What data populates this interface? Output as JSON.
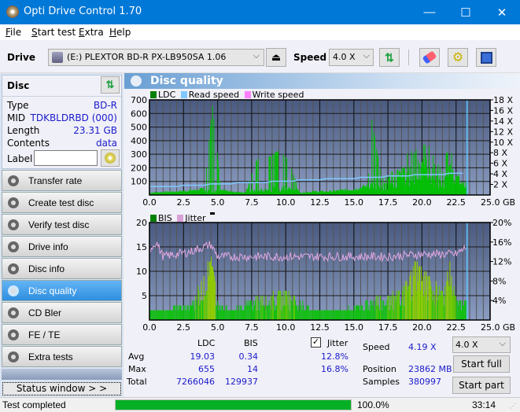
{
  "window": {
    "title": "Opti Drive Control 1.70",
    "minimize": "—",
    "maximize": "☐",
    "close": "✕"
  },
  "menu": [
    {
      "first": "F",
      "rest": "ile"
    },
    {
      "first": "S",
      "rest": "tart test"
    },
    {
      "first": "E",
      "rest": "xtra"
    },
    {
      "first": "H",
      "rest": "elp"
    }
  ],
  "toolbar": {
    "drive_label": "Drive",
    "drive_value": "(E:)  PLEXTOR BD-R  PX-LB950SA 1.06",
    "speed_label": "Speed",
    "speed_value": "4.0 X"
  },
  "disc": {
    "header": "Disc",
    "rows": [
      {
        "label": "Type",
        "value": "BD-R"
      },
      {
        "label": "MID",
        "value": "TDKBLDRBD (000)"
      },
      {
        "label": "Length",
        "value": "23.31 GB"
      },
      {
        "label": "Contents",
        "value": "data"
      }
    ],
    "label_field": "Label",
    "label_value": ""
  },
  "nav": [
    {
      "label": "Transfer rate",
      "active": false
    },
    {
      "label": "Create test disc",
      "active": false
    },
    {
      "label": "Verify test disc",
      "active": false
    },
    {
      "label": "Drive info",
      "active": false
    },
    {
      "label": "Disc info",
      "active": false
    },
    {
      "label": "Disc quality",
      "active": true
    },
    {
      "label": "CD Bler",
      "active": false
    },
    {
      "label": "FE / TE",
      "active": false
    },
    {
      "label": "Extra tests",
      "active": false
    }
  ],
  "status_window": "Status window > >",
  "panel_title": "Disc quality",
  "chart_data": [
    {
      "type": "bar",
      "title": "LDC",
      "legend": [
        "LDC",
        "Read speed",
        "Write speed"
      ],
      "colors": {
        "LDC": "#00c000",
        "Read speed": "#80c8ff",
        "Write speed": "#ff80ff"
      },
      "xlabel": "GB",
      "x_ticks": [
        "0.0",
        "2.5",
        "5.0",
        "7.5",
        "10.0",
        "12.5",
        "15.0",
        "17.5",
        "20.0",
        "22.5",
        "25.0 GB"
      ],
      "xlim": [
        0,
        25
      ],
      "ylim": [
        0,
        700
      ],
      "y_ticks": [
        "100",
        "200",
        "300",
        "400",
        "500",
        "600",
        "700"
      ],
      "y2_ticks": [
        "2 X",
        "4 X",
        "6 X",
        "8 X",
        "10 X",
        "12 X",
        "14 X",
        "16 X",
        "18 X"
      ],
      "y2lim": [
        0,
        18
      ],
      "ldc_profile": [
        [
          0,
          20
        ],
        [
          1,
          25
        ],
        [
          2,
          30
        ],
        [
          3,
          40
        ],
        [
          4,
          50
        ],
        [
          4.6,
          655
        ],
        [
          4.8,
          470
        ],
        [
          5.2,
          45
        ],
        [
          6,
          25
        ],
        [
          7,
          20
        ],
        [
          7.9,
          270
        ],
        [
          8.3,
          250
        ],
        [
          9.5,
          330
        ],
        [
          9.8,
          300
        ],
        [
          10.2,
          250
        ],
        [
          11,
          20
        ],
        [
          12,
          30
        ],
        [
          13,
          30
        ],
        [
          14,
          40
        ],
        [
          15,
          50
        ],
        [
          16,
          80
        ],
        [
          16.3,
          550
        ],
        [
          17,
          130
        ],
        [
          18,
          170
        ],
        [
          19,
          300
        ],
        [
          19.5,
          380
        ],
        [
          20,
          410
        ],
        [
          20.5,
          340
        ],
        [
          21,
          230
        ],
        [
          21.5,
          190
        ],
        [
          22,
          370
        ],
        [
          22.3,
          300
        ],
        [
          22.8,
          90
        ],
        [
          23.31,
          90
        ]
      ],
      "read_speed": [
        [
          0,
          1.5
        ],
        [
          23.31,
          4.19
        ]
      ],
      "end_marker_gb": 23.31
    },
    {
      "type": "bar",
      "title": "BIS / Jitter",
      "legend": [
        "BIS",
        "Jitter"
      ],
      "colors": {
        "BIS": "#00c000",
        "Jitter": "#e0a0e0"
      },
      "x_ticks": [
        "0.0",
        "2.5",
        "5.0",
        "7.5",
        "10.0",
        "12.5",
        "15.0",
        "17.5",
        "20.0",
        "22.5",
        "25.0 GB"
      ],
      "xlim": [
        0,
        25
      ],
      "ylim": [
        0,
        20
      ],
      "y_ticks": [
        "5",
        "10",
        "15",
        "20"
      ],
      "y2_ticks": [
        "4%",
        "8%",
        "12%",
        "16%",
        "20%"
      ],
      "y2lim": [
        0,
        20
      ],
      "bis_profile": [
        [
          0,
          2
        ],
        [
          3,
          3
        ],
        [
          4.6,
          14
        ],
        [
          5,
          4
        ],
        [
          6,
          2
        ],
        [
          8,
          5
        ],
        [
          10,
          6
        ],
        [
          12,
          2
        ],
        [
          14,
          2
        ],
        [
          15,
          3
        ],
        [
          17,
          5
        ],
        [
          18.5,
          6
        ],
        [
          19.5,
          12
        ],
        [
          20.5,
          9
        ],
        [
          21.5,
          6
        ],
        [
          22,
          12
        ],
        [
          22.5,
          4
        ],
        [
          23.31,
          4
        ]
      ],
      "jitter_profile": [
        [
          0,
          14.5
        ],
        [
          0.5,
          16
        ],
        [
          1,
          13
        ],
        [
          3,
          14
        ],
        [
          4.5,
          15.5
        ],
        [
          5,
          13
        ],
        [
          7.5,
          13
        ],
        [
          12.5,
          13
        ],
        [
          17.5,
          13
        ],
        [
          20,
          13.5
        ],
        [
          22.5,
          13.5
        ],
        [
          23.31,
          15
        ]
      ],
      "end_marker_gb": 23.31
    }
  ],
  "stats": {
    "col_ldc": "LDC",
    "col_bis": "BIS",
    "jitter_label": "Jitter",
    "jitter_checked": true,
    "rows": [
      {
        "label": "Avg",
        "ldc": "19.03",
        "bis": "0.34",
        "jitter": "12.8%"
      },
      {
        "label": "Max",
        "ldc": "655",
        "bis": "14",
        "jitter": "16.8%"
      },
      {
        "label": "Total",
        "ldc": "7266046",
        "bis": "129937",
        "jitter": ""
      }
    ],
    "speed_label": "Speed",
    "speed_value": "4.19 X",
    "position_label": "Position",
    "position_value": "23862 MB",
    "samples_label": "Samples",
    "samples_value": "380997",
    "speed_select": "4.0 X",
    "start_full": "Start full",
    "start_part": "Start part"
  },
  "statusbar": {
    "text": "Test completed",
    "progress": 100.0,
    "progress_text": "100.0%",
    "time": "33:14"
  }
}
